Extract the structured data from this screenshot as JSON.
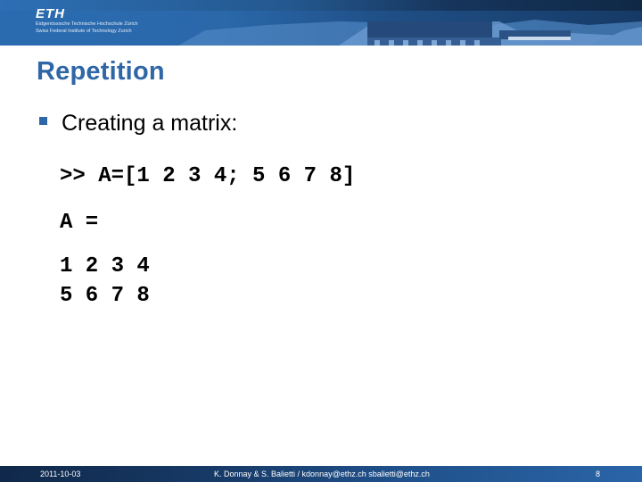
{
  "header": {
    "logo_mark": "ETH",
    "logo_line1": "Eidgenössische Technische Hochschule Zürich",
    "logo_line2": "Swiss Federal Institute of Technology Zurich"
  },
  "slide": {
    "title": "Repetition",
    "bullets": [
      {
        "text": "Creating a matrix:"
      }
    ],
    "code_lines": [
      ">> A=[1 2 3 4; 5 6 7 8]",
      "A =",
      "1 2 3 4",
      "5 6 7 8"
    ]
  },
  "footer": {
    "date": "2011-10-03",
    "authors": "K. Donnay & S. Balietti / kdonnay@ethz.ch  sbalietti@ethz.ch",
    "page_number": "8"
  },
  "colors": {
    "accent": "#2f66a6",
    "header_blue": "#2a6bb0",
    "footer_dark": "#10284a"
  }
}
